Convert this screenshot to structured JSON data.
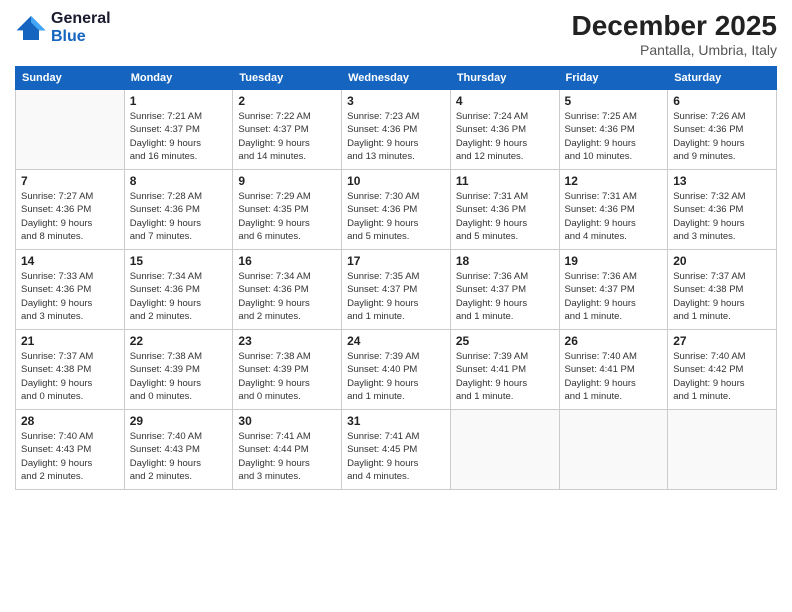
{
  "logo": {
    "line1": "General",
    "line2": "Blue"
  },
  "title": "December 2025",
  "location": "Pantalla, Umbria, Italy",
  "days_of_week": [
    "Sunday",
    "Monday",
    "Tuesday",
    "Wednesday",
    "Thursday",
    "Friday",
    "Saturday"
  ],
  "weeks": [
    [
      {
        "day": "",
        "info": ""
      },
      {
        "day": "1",
        "info": "Sunrise: 7:21 AM\nSunset: 4:37 PM\nDaylight: 9 hours\nand 16 minutes."
      },
      {
        "day": "2",
        "info": "Sunrise: 7:22 AM\nSunset: 4:37 PM\nDaylight: 9 hours\nand 14 minutes."
      },
      {
        "day": "3",
        "info": "Sunrise: 7:23 AM\nSunset: 4:36 PM\nDaylight: 9 hours\nand 13 minutes."
      },
      {
        "day": "4",
        "info": "Sunrise: 7:24 AM\nSunset: 4:36 PM\nDaylight: 9 hours\nand 12 minutes."
      },
      {
        "day": "5",
        "info": "Sunrise: 7:25 AM\nSunset: 4:36 PM\nDaylight: 9 hours\nand 10 minutes."
      },
      {
        "day": "6",
        "info": "Sunrise: 7:26 AM\nSunset: 4:36 PM\nDaylight: 9 hours\nand 9 minutes."
      }
    ],
    [
      {
        "day": "7",
        "info": "Sunrise: 7:27 AM\nSunset: 4:36 PM\nDaylight: 9 hours\nand 8 minutes."
      },
      {
        "day": "8",
        "info": "Sunrise: 7:28 AM\nSunset: 4:36 PM\nDaylight: 9 hours\nand 7 minutes."
      },
      {
        "day": "9",
        "info": "Sunrise: 7:29 AM\nSunset: 4:35 PM\nDaylight: 9 hours\nand 6 minutes."
      },
      {
        "day": "10",
        "info": "Sunrise: 7:30 AM\nSunset: 4:36 PM\nDaylight: 9 hours\nand 5 minutes."
      },
      {
        "day": "11",
        "info": "Sunrise: 7:31 AM\nSunset: 4:36 PM\nDaylight: 9 hours\nand 5 minutes."
      },
      {
        "day": "12",
        "info": "Sunrise: 7:31 AM\nSunset: 4:36 PM\nDaylight: 9 hours\nand 4 minutes."
      },
      {
        "day": "13",
        "info": "Sunrise: 7:32 AM\nSunset: 4:36 PM\nDaylight: 9 hours\nand 3 minutes."
      }
    ],
    [
      {
        "day": "14",
        "info": "Sunrise: 7:33 AM\nSunset: 4:36 PM\nDaylight: 9 hours\nand 3 minutes."
      },
      {
        "day": "15",
        "info": "Sunrise: 7:34 AM\nSunset: 4:36 PM\nDaylight: 9 hours\nand 2 minutes."
      },
      {
        "day": "16",
        "info": "Sunrise: 7:34 AM\nSunset: 4:36 PM\nDaylight: 9 hours\nand 2 minutes."
      },
      {
        "day": "17",
        "info": "Sunrise: 7:35 AM\nSunset: 4:37 PM\nDaylight: 9 hours\nand 1 minute."
      },
      {
        "day": "18",
        "info": "Sunrise: 7:36 AM\nSunset: 4:37 PM\nDaylight: 9 hours\nand 1 minute."
      },
      {
        "day": "19",
        "info": "Sunrise: 7:36 AM\nSunset: 4:37 PM\nDaylight: 9 hours\nand 1 minute."
      },
      {
        "day": "20",
        "info": "Sunrise: 7:37 AM\nSunset: 4:38 PM\nDaylight: 9 hours\nand 1 minute."
      }
    ],
    [
      {
        "day": "21",
        "info": "Sunrise: 7:37 AM\nSunset: 4:38 PM\nDaylight: 9 hours\nand 0 minutes."
      },
      {
        "day": "22",
        "info": "Sunrise: 7:38 AM\nSunset: 4:39 PM\nDaylight: 9 hours\nand 0 minutes."
      },
      {
        "day": "23",
        "info": "Sunrise: 7:38 AM\nSunset: 4:39 PM\nDaylight: 9 hours\nand 0 minutes."
      },
      {
        "day": "24",
        "info": "Sunrise: 7:39 AM\nSunset: 4:40 PM\nDaylight: 9 hours\nand 1 minute."
      },
      {
        "day": "25",
        "info": "Sunrise: 7:39 AM\nSunset: 4:41 PM\nDaylight: 9 hours\nand 1 minute."
      },
      {
        "day": "26",
        "info": "Sunrise: 7:40 AM\nSunset: 4:41 PM\nDaylight: 9 hours\nand 1 minute."
      },
      {
        "day": "27",
        "info": "Sunrise: 7:40 AM\nSunset: 4:42 PM\nDaylight: 9 hours\nand 1 minute."
      }
    ],
    [
      {
        "day": "28",
        "info": "Sunrise: 7:40 AM\nSunset: 4:43 PM\nDaylight: 9 hours\nand 2 minutes."
      },
      {
        "day": "29",
        "info": "Sunrise: 7:40 AM\nSunset: 4:43 PM\nDaylight: 9 hours\nand 2 minutes."
      },
      {
        "day": "30",
        "info": "Sunrise: 7:41 AM\nSunset: 4:44 PM\nDaylight: 9 hours\nand 3 minutes."
      },
      {
        "day": "31",
        "info": "Sunrise: 7:41 AM\nSunset: 4:45 PM\nDaylight: 9 hours\nand 4 minutes."
      },
      {
        "day": "",
        "info": ""
      },
      {
        "day": "",
        "info": ""
      },
      {
        "day": "",
        "info": ""
      }
    ]
  ]
}
